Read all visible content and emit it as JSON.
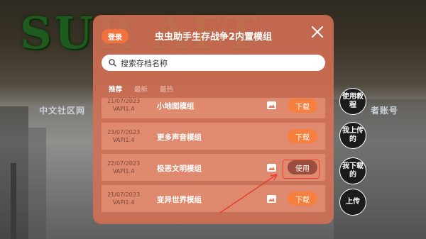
{
  "background": {
    "title": "SUR          AFT",
    "subtitle_left": "中文社区网",
    "subtitle_right": "者账号"
  },
  "dialog": {
    "login_label": "登录",
    "title": "虫虫助手生存战争2内置模组",
    "search_placeholder": "搜索存档名称",
    "tabs": [
      "推荐",
      "最新",
      "最热"
    ],
    "rows": [
      {
        "date": "21/07/2023",
        "version": "VAPI1.4",
        "name": "小地图模组",
        "has_image": true,
        "action": "下载"
      },
      {
        "date": "23/07/2023",
        "version": "VAPI1.4",
        "name": "更多声音模组",
        "has_image": false,
        "action": "下载"
      },
      {
        "date": "22/07/2023",
        "version": "VAPI1.4",
        "name": "极恶文明模组",
        "has_image": true,
        "action": "使用"
      },
      {
        "date": "21/07/2023",
        "version": "VAPI1.4",
        "name": "变异世界模组",
        "has_image": true,
        "action": "下载"
      }
    ]
  },
  "side_buttons": {
    "tutorial": "使用教程",
    "my_uploads": "我上传的",
    "my_downloads": "我下载的",
    "upload": "上传"
  },
  "colors": {
    "dialog_bg": "#d57054",
    "primary_button": "#f5803f",
    "highlight": "#e5402d"
  }
}
